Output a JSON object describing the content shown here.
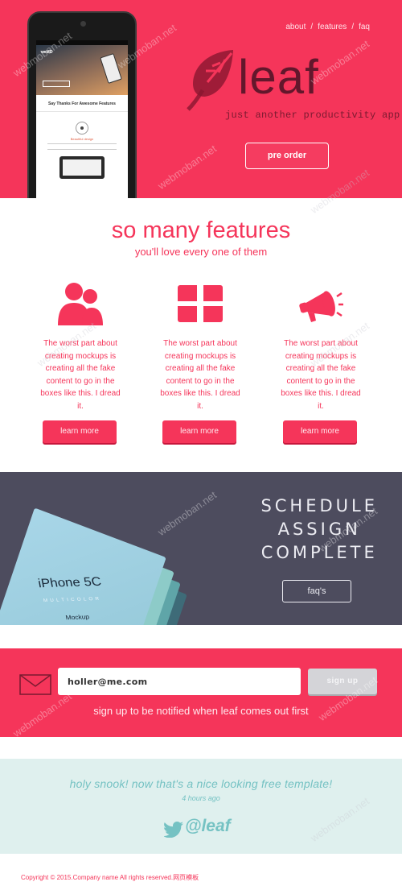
{
  "nav": {
    "items": [
      "about",
      "features",
      "faq"
    ],
    "separator": "/"
  },
  "hero": {
    "brand": "leaf",
    "tagline": "just another productivity app",
    "preorder_label": "pre order",
    "accent_color": "#f5355a",
    "phone": {
      "screen_logo": "weMD",
      "screen_thanks": "Say Thanks For Awesome Features",
      "screen_design": "Beautiful design"
    }
  },
  "features": {
    "title": "so many features",
    "subtitle": "you'll love every one of them",
    "items": [
      {
        "icon": "users-icon",
        "text": "The worst part about creating mockups is creating all the fake content to go in the boxes like this. I dread it.",
        "button": "learn more"
      },
      {
        "icon": "grid-icon",
        "text": "The worst part about creating mockups is creating all the fake content to go in the boxes like this. I dread it.",
        "button": "learn more"
      },
      {
        "icon": "megaphone-icon",
        "text": "The worst part about creating mockups is creating all the fake content to go in the boxes like this. I dread it.",
        "button": "learn more"
      }
    ]
  },
  "schedule": {
    "lines": [
      "SCHEDULE",
      "ASSIGN",
      "COMPLETE"
    ],
    "button": "faq's",
    "mockup": {
      "model": "iPhone 5C",
      "multi": "MULTICOLOR",
      "mockup_label": "Mockup"
    },
    "background_color": "#4d4c5e"
  },
  "signup": {
    "email_value": "holler@me.com",
    "button": "sign up",
    "note": "sign up to be notified when leaf comes out first"
  },
  "tweet": {
    "text": "holy snook! now that's a nice looking free template!",
    "time": "4 hours ago",
    "handle": "@leaf",
    "color": "#75c2c3"
  },
  "footer": {
    "copyright": "Copyright © 2015.Company name All rights reserved.网页模板"
  },
  "watermark": "webmoban.net"
}
